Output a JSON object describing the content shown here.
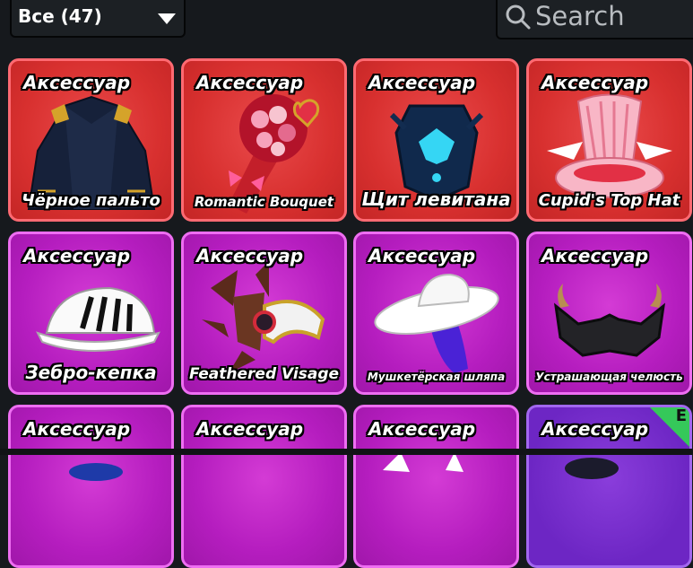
{
  "filter": {
    "label": "Все (47)"
  },
  "search": {
    "placeholder": "Search"
  },
  "items": [
    {
      "type": "Аксессуар",
      "name": "Чёрное пальто"
    },
    {
      "type": "Аксессуар",
      "name": "Romantic Bouquet"
    },
    {
      "type": "Аксессуар",
      "name": "Щит левитана"
    },
    {
      "type": "Аксессуар",
      "name": "Cupid's Top Hat"
    },
    {
      "type": "Аксессуар",
      "name": "Зебро-кепка"
    },
    {
      "type": "Аксессуар",
      "name": "Feathered Visage"
    },
    {
      "type": "Аксессуар",
      "name": "Мушкетёрская шляпа"
    },
    {
      "type": "Аксессуар",
      "name": "Устрашающая челюсть"
    },
    {
      "type": "Аксессуар",
      "name": ""
    },
    {
      "type": "Аксессуар",
      "name": ""
    },
    {
      "type": "Аксессуар",
      "name": ""
    },
    {
      "type": "Аксессуар",
      "name": "",
      "badge": "E"
    }
  ],
  "colors": {
    "legendary": "#d8302f",
    "epic": "#b51dbf",
    "rare": "#6d26c4",
    "badge": "#35c85a"
  }
}
